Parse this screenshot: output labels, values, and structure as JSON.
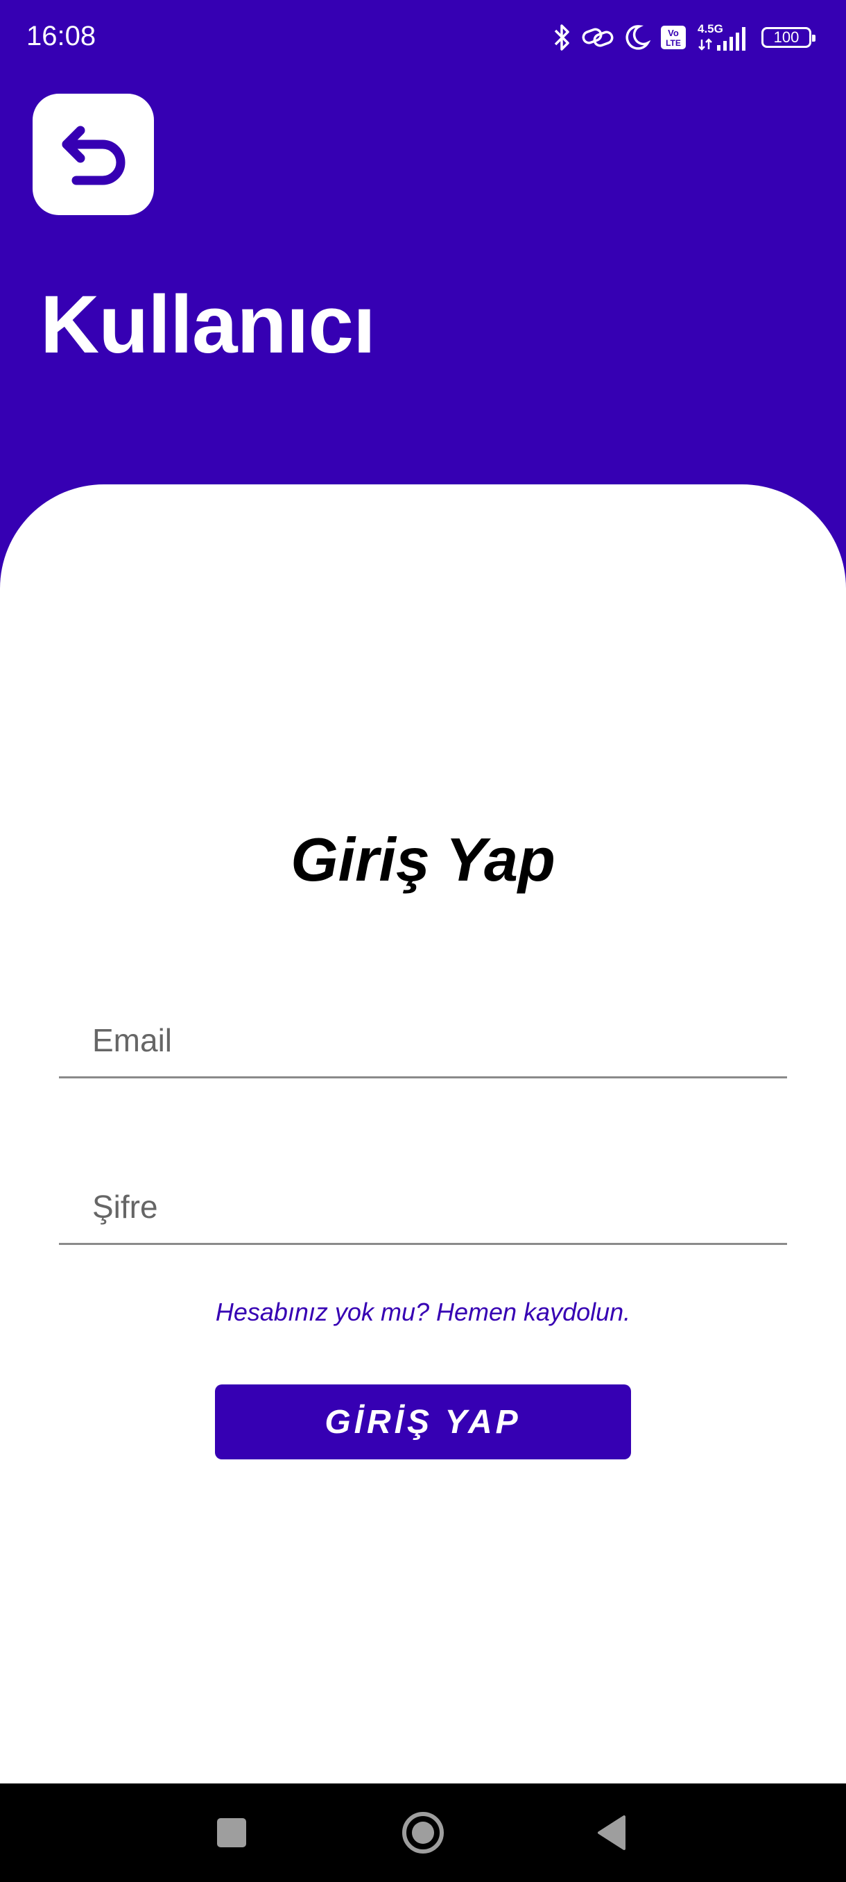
{
  "status_bar": {
    "time": "16:08",
    "battery": "100",
    "network": "4.5G",
    "volte": "Vo LTE"
  },
  "header": {
    "back_icon": "return-arrow-icon",
    "title": "Kullanıcı"
  },
  "form": {
    "title": "Giriş Yap",
    "email_placeholder": "Email",
    "password_placeholder": "Şifre",
    "signup_link": "Hesabınız yok mu? Hemen kaydolun.",
    "submit_label": "GİRİŞ YAP"
  },
  "nav_bar": {
    "icons": [
      "square-recents-icon",
      "circle-home-icon",
      "triangle-back-icon"
    ]
  },
  "colors": {
    "primary": "#3600b3",
    "background": "#ffffff",
    "nav": "#000000"
  }
}
